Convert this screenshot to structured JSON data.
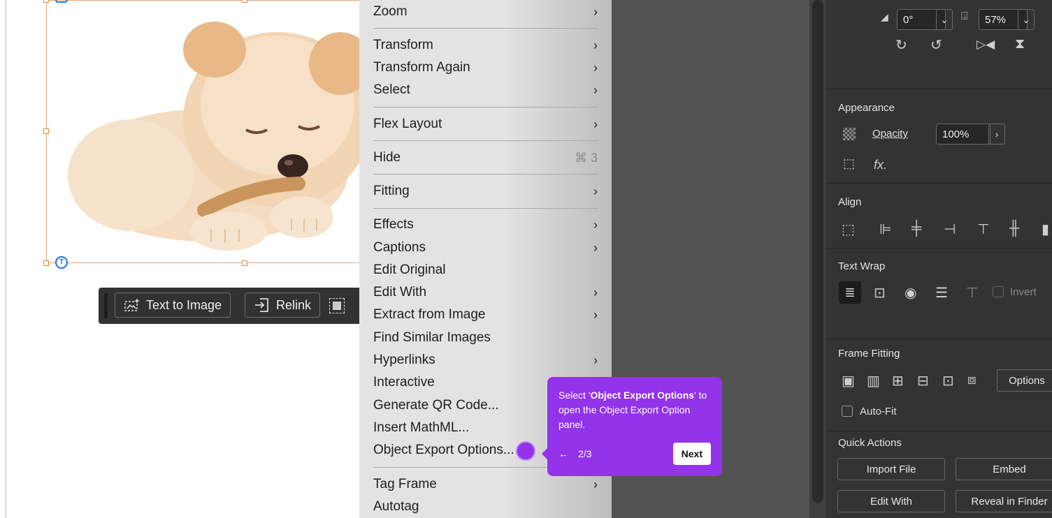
{
  "taskbar": {
    "text_to_image": "Text to Image",
    "relink": "Relink"
  },
  "frame": {
    "type_badge": "T"
  },
  "context_menu": {
    "items": [
      {
        "label": "Zoom",
        "submenu": true
      },
      {
        "label": "Transform",
        "submenu": true
      },
      {
        "label": "Transform Again",
        "submenu": true
      },
      {
        "label": "Select",
        "submenu": true
      },
      {
        "label": "Flex Layout",
        "submenu": true
      },
      {
        "label": "Hide",
        "shortcut": "⌘ 3"
      },
      {
        "label": "Fitting",
        "submenu": true
      },
      {
        "label": "Effects",
        "submenu": true
      },
      {
        "label": "Captions",
        "submenu": true
      },
      {
        "label": "Edit Original"
      },
      {
        "label": "Edit With",
        "submenu": true
      },
      {
        "label": "Extract from Image",
        "submenu": true
      },
      {
        "label": "Find Similar Images"
      },
      {
        "label": "Hyperlinks",
        "submenu": true
      },
      {
        "label": "Interactive"
      },
      {
        "label": "Generate QR Code..."
      },
      {
        "label": "Insert MathML..."
      },
      {
        "label": "Object Export Options..."
      },
      {
        "label": "Tag Frame",
        "submenu": true
      },
      {
        "label": "Autotag"
      }
    ],
    "chevron": "›"
  },
  "tooltip": {
    "text_before": "Select '",
    "text_bold": "Object Export Options",
    "text_after": "' to open the Object Export Option panel.",
    "step": "2/3",
    "back_arrow": "←",
    "next_label": "Next"
  },
  "properties": {
    "transform": {
      "shear_value": "0°",
      "scale_value": "57%"
    },
    "appearance": {
      "title": "Appearance",
      "opacity_label": "Opacity",
      "opacity_value": "100%",
      "fx_label": "fx."
    },
    "align": {
      "title": "Align"
    },
    "text_wrap": {
      "title": "Text Wrap",
      "invert_label": "Invert"
    },
    "frame_fitting": {
      "title": "Frame Fitting",
      "options_label": "Options",
      "auto_fit_label": "Auto-Fit"
    },
    "quick_actions": {
      "title": "Quick Actions",
      "import_file": "Import File",
      "embed": "Embed",
      "edit_with": "Edit With",
      "reveal_in_finder": "Reveal in Finder"
    }
  },
  "colors": {
    "accent_purple": "#9333ea",
    "selection_blue": "#1a73e8",
    "frame_orange": "#e0a77a"
  }
}
